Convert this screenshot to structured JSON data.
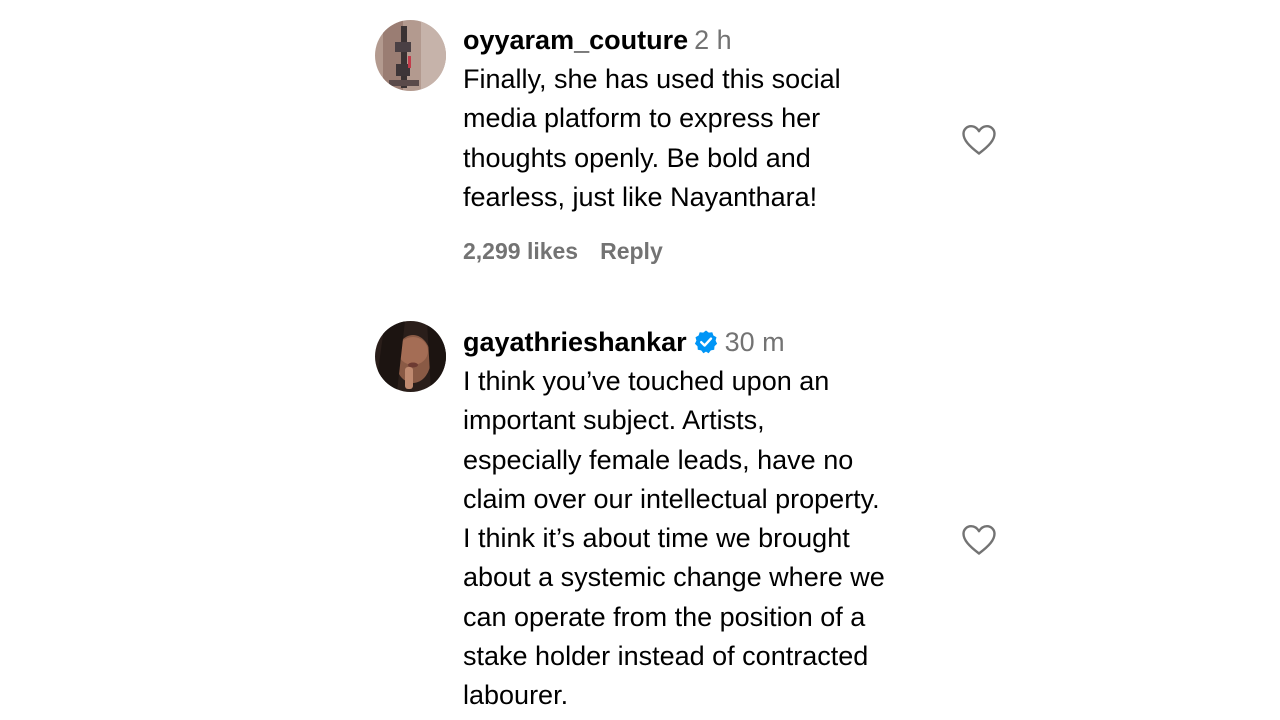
{
  "comments": [
    {
      "username": "oyyaram_couture",
      "verified": false,
      "time": "2 h",
      "lines": [
        "Finally, she has used this social",
        "media platform to express her",
        "thoughts openly. Be bold and",
        "fearless, just like Nayanthara!"
      ],
      "likes": "2,299 likes",
      "reply_label": "Reply",
      "avatar_icon": "user-avatar-photo"
    },
    {
      "username": "gayathrieshankar",
      "verified": true,
      "verified_icon": "verified-badge-icon",
      "verified_color": "#0095f6",
      "time": "30 m",
      "lines": [
        "I think you’ve touched upon an",
        "important subject. Artists,",
        "especially female leads, have no",
        "claim over our intellectual property.",
        "I think it’s about time we brought",
        "about a systemic change where we",
        "can operate from the position of a",
        "stake holder instead of contracted",
        "labourer."
      ],
      "avatar_icon": "user-avatar-photo"
    }
  ],
  "icons": {
    "like": "heart-outline-icon"
  },
  "colors": {
    "text": "#000000",
    "secondary": "#737373",
    "verified": "#0095f6"
  }
}
